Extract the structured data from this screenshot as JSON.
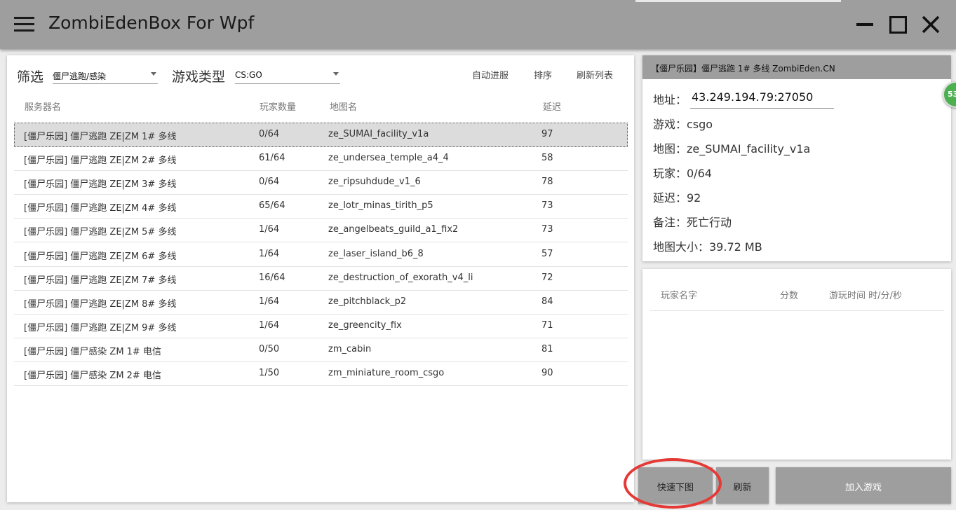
{
  "window": {
    "title": "ZombiEdenBox For Wpf",
    "menu_icon": "hamburger-menu-icon",
    "minimize_icon": "minimize-icon",
    "maximize_icon": "maximize-icon",
    "close_icon": "close-icon"
  },
  "filters": {
    "filter_label": "筛选",
    "filter_value": "僵尸逃跑/感染",
    "game_type_label": "游戏类型",
    "game_type_value": "CS:GO",
    "auto_join": "自动进服",
    "sort": "排序",
    "refresh_list": "刷新列表"
  },
  "table": {
    "headers": {
      "name": "服务器名",
      "players": "玩家数量",
      "map": "地图名",
      "ping": "延迟"
    },
    "rows": [
      {
        "name": "[僵尸乐园] 僵尸逃跑 ZE|ZM 1# 多线",
        "players": "0/64",
        "map": "ze_SUMAI_facility_v1a",
        "ping": "97"
      },
      {
        "name": "[僵尸乐园] 僵尸逃跑 ZE|ZM 2# 多线",
        "players": "61/64",
        "map": "ze_undersea_temple_a4_4",
        "ping": "58"
      },
      {
        "name": "[僵尸乐园] 僵尸逃跑 ZE|ZM 3# 多线",
        "players": "0/64",
        "map": "ze_ripsuhdude_v1_6",
        "ping": "78"
      },
      {
        "name": "[僵尸乐园] 僵尸逃跑 ZE|ZM 4# 多线",
        "players": "65/64",
        "map": "ze_lotr_minas_tirith_p5",
        "ping": "73"
      },
      {
        "name": "[僵尸乐园] 僵尸逃跑 ZE|ZM 5# 多线",
        "players": "1/64",
        "map": "ze_angelbeats_guild_a1_fix2",
        "ping": "73"
      },
      {
        "name": "[僵尸乐园] 僵尸逃跑 ZE|ZM 6# 多线",
        "players": "1/64",
        "map": "ze_laser_island_b6_8",
        "ping": "57"
      },
      {
        "name": "[僵尸乐园] 僵尸逃跑 ZE|ZM 7# 多线",
        "players": "16/64",
        "map": "ze_destruction_of_exorath_v4_li",
        "ping": "72"
      },
      {
        "name": "[僵尸乐园] 僵尸逃跑 ZE|ZM 8# 多线",
        "players": "1/64",
        "map": "ze_pitchblack_p2",
        "ping": "84"
      },
      {
        "name": "[僵尸乐园] 僵尸逃跑 ZE|ZM 9# 多线",
        "players": "1/64",
        "map": "ze_greencity_fix",
        "ping": "71"
      },
      {
        "name": "[僵尸乐园] 僵尸感染 ZM 1# 电信",
        "players": "0/50",
        "map": "zm_cabin",
        "ping": "81"
      },
      {
        "name": "[僵尸乐园] 僵尸感染 ZM 2# 电信",
        "players": "1/50",
        "map": "zm_miniature_room_csgo",
        "ping": "90"
      }
    ]
  },
  "server_info": {
    "header": "【僵尸乐园】僵尸逃跑 1# 多线 ZombiEden.CN",
    "address_label": "地址：",
    "address_value": "43.249.194.79:27050",
    "game": "游戏：csgo",
    "map": "地图：ze_SUMAI_facility_v1a",
    "players": "玩家：0/64",
    "ping": "延迟：92",
    "note": "备注：死亡行动",
    "map_size": "地图大小：39.72 MB",
    "badge": "53"
  },
  "player_list": {
    "headers": {
      "name": "玩家名字",
      "score": "分数",
      "time": "游玩时间 时/分/秒"
    }
  },
  "actions": {
    "quick_download": "快速下图",
    "refresh": "刷新",
    "join_game": "加入游戏"
  },
  "colors": {
    "titlebar": "#9e9e9e",
    "selected_row": "#dcdcdc",
    "annotation_red": "#e53935",
    "badge_green": "#4caf50"
  }
}
